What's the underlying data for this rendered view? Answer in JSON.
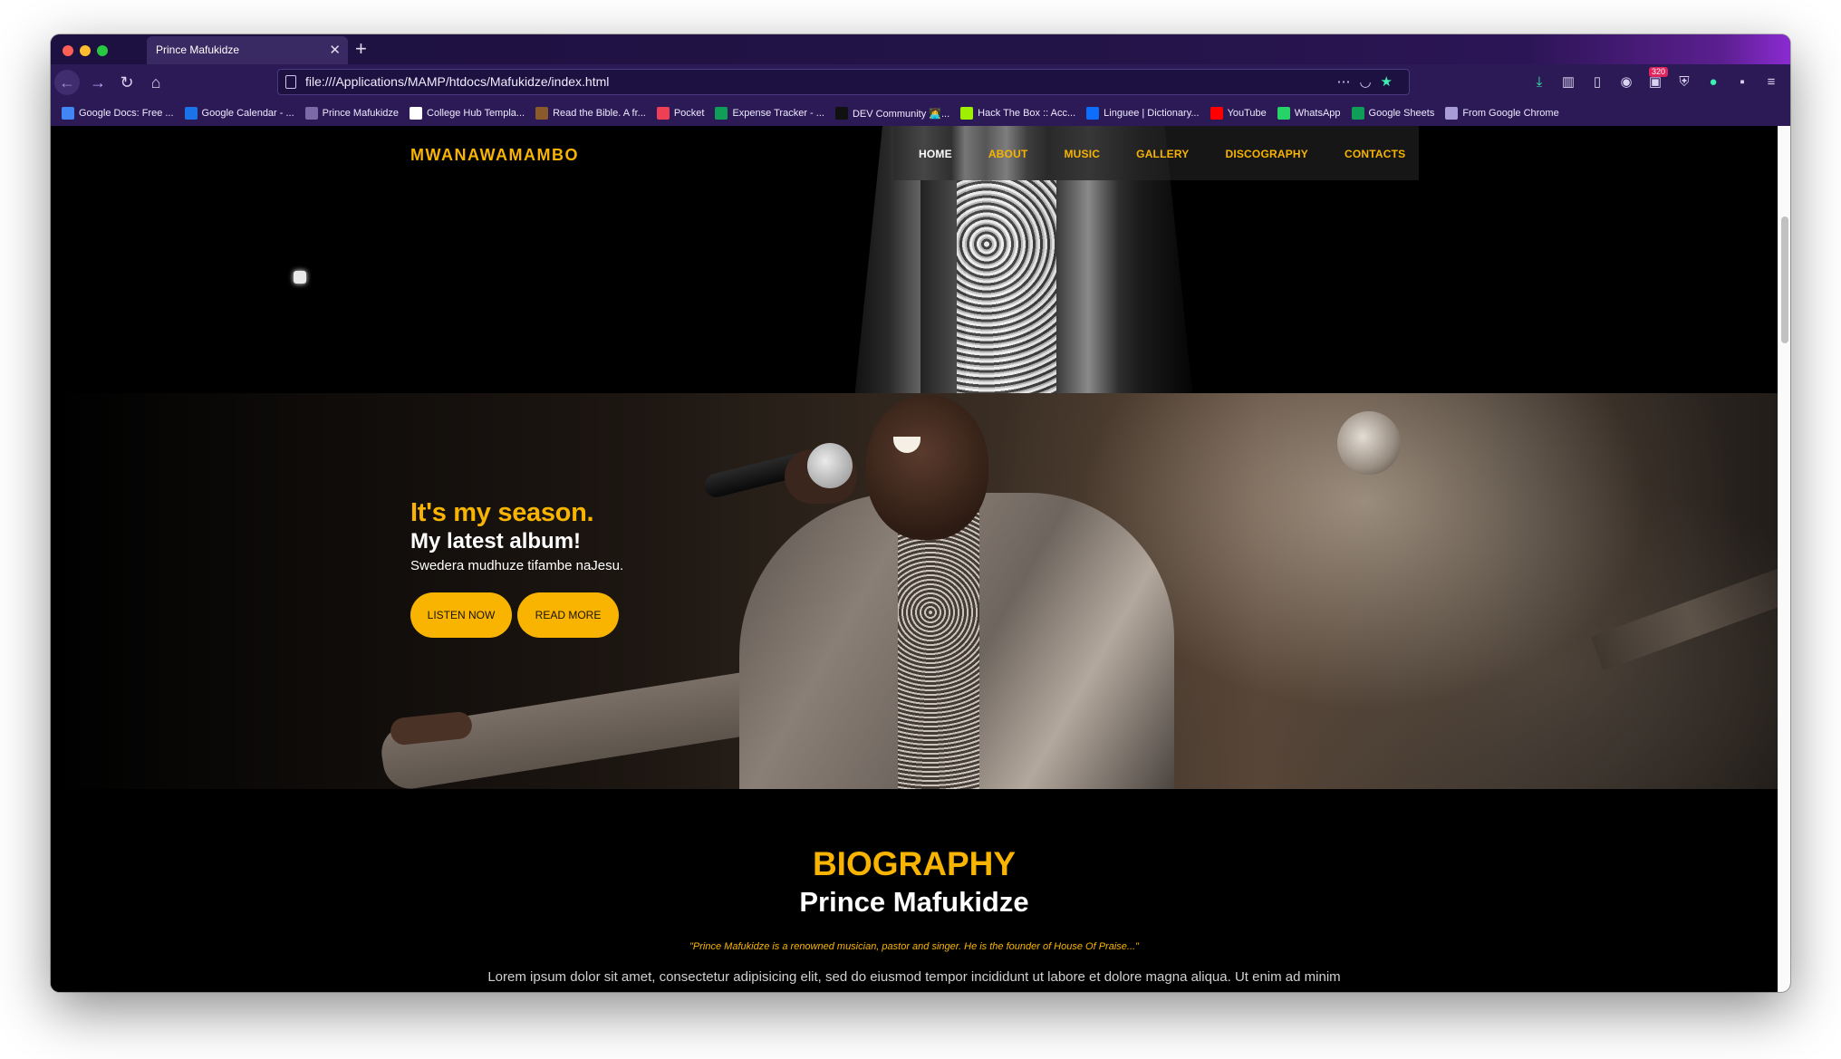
{
  "browser": {
    "tab_title": "Prince Mafukidze",
    "url": "file:///Applications/MAMP/htdocs/Mafukidze/index.html",
    "badge_count": "320",
    "bookmarks": [
      {
        "label": "Google Docs: Free ...",
        "icon": "docs-icon",
        "color": "#4285f4"
      },
      {
        "label": "Google Calendar - ...",
        "icon": "calendar-icon",
        "color": "#1a73e8"
      },
      {
        "label": "Prince Mafukidze",
        "icon": "globe-icon",
        "color": "#7b6aa8"
      },
      {
        "label": "College Hub Templa...",
        "icon": "notion-icon",
        "color": "#ffffff"
      },
      {
        "label": "Read the Bible. A fr...",
        "icon": "bible-icon",
        "color": "#8b5a2b"
      },
      {
        "label": "Pocket",
        "icon": "pocket-icon",
        "color": "#ef3f56"
      },
      {
        "label": "Expense Tracker - ...",
        "icon": "sheets-icon",
        "color": "#0f9d58"
      },
      {
        "label": "DEV Community 👩‍💻...",
        "icon": "dev-icon",
        "color": "#111111"
      },
      {
        "label": "Hack The Box :: Acc...",
        "icon": "htb-icon",
        "color": "#9fef00"
      },
      {
        "label": "Linguee | Dictionary...",
        "icon": "linguee-icon",
        "color": "#0d6efd"
      },
      {
        "label": "YouTube",
        "icon": "youtube-icon",
        "color": "#ff0000"
      },
      {
        "label": "WhatsApp",
        "icon": "whatsapp-icon",
        "color": "#25d366"
      },
      {
        "label": "Google Sheets",
        "icon": "sheets-icon",
        "color": "#0f9d58"
      },
      {
        "label": "From Google Chrome",
        "icon": "folder-icon",
        "color": "#a89cd6"
      }
    ]
  },
  "site": {
    "logo": "MWANAWAMAMBO",
    "menu": [
      {
        "label": "HOME",
        "active": true
      },
      {
        "label": "ABOUT",
        "active": false
      },
      {
        "label": "MUSIC",
        "active": false
      },
      {
        "label": "GALLERY",
        "active": false
      },
      {
        "label": "DISCOGRAPHY",
        "active": false
      },
      {
        "label": "CONTACTS",
        "active": false
      }
    ],
    "hero": {
      "title": "It's my season.",
      "subtitle": "My latest album!",
      "description": "Swedera mudhuze tifambe naJesu.",
      "listen_label": "LISTEN NOW",
      "read_label": "READ MORE"
    },
    "bio": {
      "heading": "BIOGRAPHY",
      "name": "Prince Mafukidze",
      "quote": "\"Prince Mafukidze is a renowned musician, pastor and singer. He is the founder of House Of Praise...\"",
      "body": "Lorem ipsum dolor sit amet, consectetur adipisicing elit, sed do eiusmod tempor incididunt ut labore et dolore magna aliqua. Ut enim ad minim"
    },
    "accent_color": "#f8b400"
  }
}
